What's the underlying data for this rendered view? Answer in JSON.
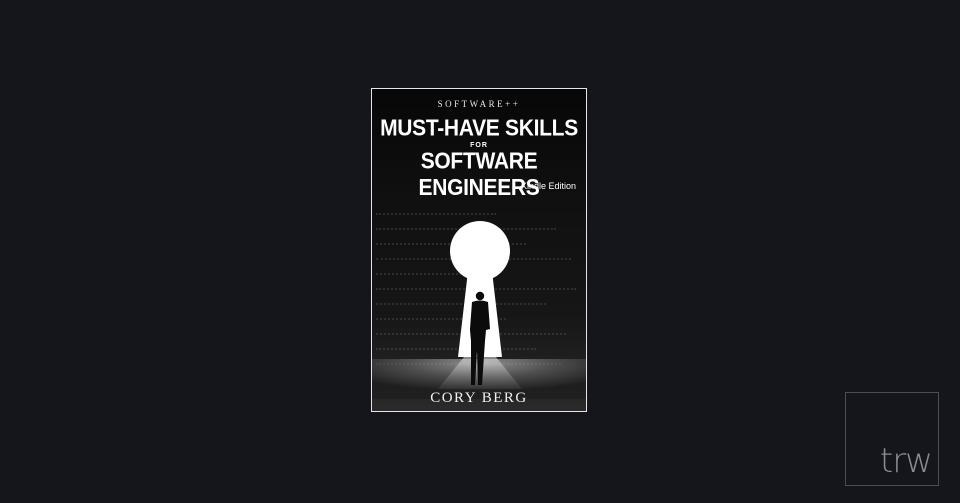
{
  "cover": {
    "series": "SOFTWARE++",
    "title_line1": "MUST-HAVE SKILLS",
    "title_line2": "FOR",
    "title_line3": "SOFTWARE ENGINEERS",
    "edition": "Kindle Edition",
    "author": "CORY BERG"
  },
  "logo": {
    "text": "trw"
  },
  "colors": {
    "background": "#14161b",
    "cover_border": "#e6e6e6",
    "logo_text": "#8a8d94"
  }
}
